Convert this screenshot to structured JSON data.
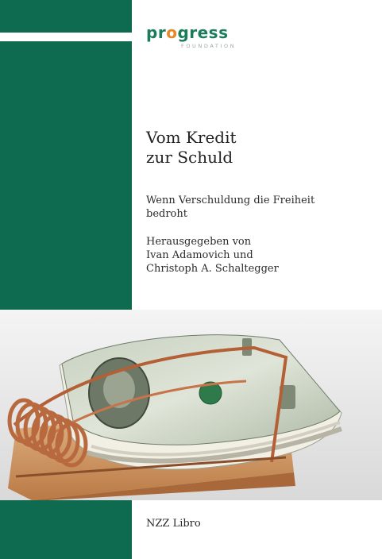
{
  "logo": {
    "word_prefix": "pr",
    "word_dot": "o",
    "word_suffix": "gress",
    "sub": "FOUNDATION"
  },
  "title": {
    "line1": "Vom Kredit",
    "line2": "zur Schuld"
  },
  "subtitle": {
    "line1": "Wenn Verschuldung die Freiheit",
    "line2": "bedroht"
  },
  "editors": {
    "line1": "Herausgegeben von",
    "line2": "Ivan Adamovich und",
    "line3": "Christoph A. Schaltegger"
  },
  "publisher": "NZZ Libro",
  "colors": {
    "brand_green": "#0f6b4f",
    "logo_green": "#1b7c5a",
    "logo_dot_orange": "#e8862a"
  }
}
